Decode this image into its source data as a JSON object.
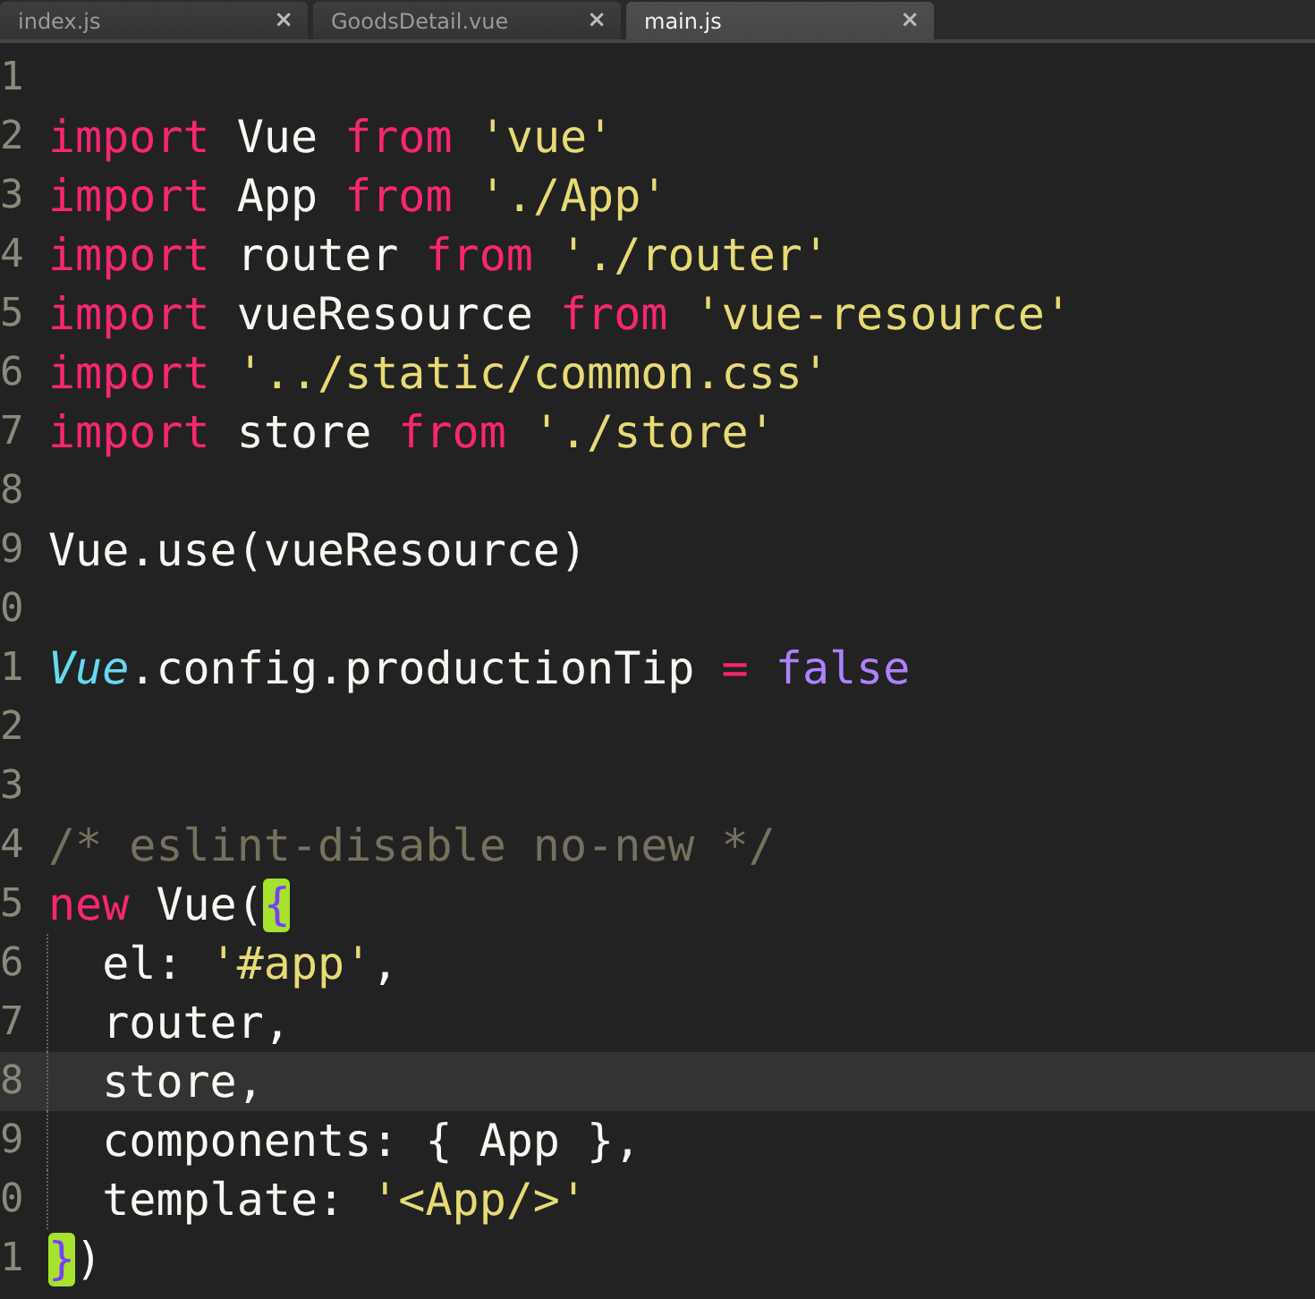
{
  "tabs": [
    {
      "label": "index.js",
      "close": "×",
      "selected": false
    },
    {
      "label": "GoodsDetail.vue",
      "close": "×",
      "selected": false
    },
    {
      "label": "main.js",
      "close": "×",
      "selected": true
    }
  ],
  "editor": {
    "lines": [
      {
        "number": "1",
        "current": false,
        "indent_guide": false
      },
      {
        "number": "2",
        "current": false,
        "indent_guide": false,
        "tokens": [
          {
            "kind": "keyword",
            "text": "import"
          },
          {
            "kind": "plain",
            "text": " Vue "
          },
          {
            "kind": "keyword",
            "text": "from "
          },
          {
            "kind": "string",
            "text": "'vue'"
          }
        ]
      },
      {
        "number": "3",
        "current": false,
        "indent_guide": false,
        "tokens": [
          {
            "kind": "keyword",
            "text": "import"
          },
          {
            "kind": "plain",
            "text": " App "
          },
          {
            "kind": "keyword",
            "text": "from "
          },
          {
            "kind": "string",
            "text": "'./App'"
          }
        ]
      },
      {
        "number": "4",
        "current": false,
        "indent_guide": false,
        "tokens": [
          {
            "kind": "keyword",
            "text": "import"
          },
          {
            "kind": "plain",
            "text": " router "
          },
          {
            "kind": "keyword",
            "text": "from "
          },
          {
            "kind": "string",
            "text": "'./router'"
          }
        ]
      },
      {
        "number": "5",
        "current": false,
        "indent_guide": false,
        "tokens": [
          {
            "kind": "keyword",
            "text": "import"
          },
          {
            "kind": "plain",
            "text": " vueResource "
          },
          {
            "kind": "keyword",
            "text": "from "
          },
          {
            "kind": "string",
            "text": "'vue-resource'"
          }
        ]
      },
      {
        "number": "6",
        "current": false,
        "indent_guide": false,
        "tokens": [
          {
            "kind": "keyword",
            "text": "import "
          },
          {
            "kind": "string",
            "text": "'../static/common.css'"
          }
        ]
      },
      {
        "number": "7",
        "current": false,
        "indent_guide": false,
        "tokens": [
          {
            "kind": "keyword",
            "text": "import"
          },
          {
            "kind": "plain",
            "text": " store "
          },
          {
            "kind": "keyword",
            "text": "from "
          },
          {
            "kind": "string",
            "text": "'./store'"
          }
        ]
      },
      {
        "number": "8",
        "current": false,
        "indent_guide": false
      },
      {
        "number": "9",
        "current": false,
        "indent_guide": false,
        "tokens": [
          {
            "kind": "plain",
            "text": "Vue.use(vueResource)"
          }
        ]
      },
      {
        "number": "0",
        "current": false,
        "indent_guide": false
      },
      {
        "number": "1",
        "current": false,
        "indent_guide": false,
        "tokens": [
          {
            "kind": "class",
            "text": "Vue"
          },
          {
            "kind": "plain",
            "text": ".config.productionTip "
          },
          {
            "kind": "keyword",
            "text": "= "
          },
          {
            "kind": "constant",
            "text": "false"
          }
        ]
      },
      {
        "number": "2",
        "current": false,
        "indent_guide": false
      },
      {
        "number": "3",
        "current": false,
        "indent_guide": false
      },
      {
        "number": "4",
        "current": false,
        "indent_guide": false,
        "tokens": [
          {
            "kind": "comment",
            "text": "/* eslint-disable no-new */"
          }
        ]
      },
      {
        "number": "5",
        "current": false,
        "indent_guide": false,
        "tokens": [
          {
            "kind": "keyword",
            "text": "new"
          },
          {
            "kind": "plain",
            "text": " Vue("
          },
          {
            "kind": "bracket-match",
            "text": "{"
          }
        ]
      },
      {
        "number": "6",
        "current": false,
        "indent_guide": true,
        "tokens": [
          {
            "kind": "plain",
            "text": "  el: "
          },
          {
            "kind": "string",
            "text": "'#app'"
          },
          {
            "kind": "plain",
            "text": ","
          }
        ]
      },
      {
        "number": "7",
        "current": false,
        "indent_guide": true,
        "tokens": [
          {
            "kind": "plain",
            "text": "  router,"
          }
        ]
      },
      {
        "number": "8",
        "current": true,
        "indent_guide": true,
        "tokens": [
          {
            "kind": "plain",
            "text": "  store,"
          }
        ]
      },
      {
        "number": "9",
        "current": false,
        "indent_guide": true,
        "tokens": [
          {
            "kind": "plain",
            "text": "  components: { App },"
          }
        ]
      },
      {
        "number": "0",
        "current": false,
        "indent_guide": true,
        "tokens": [
          {
            "kind": "plain",
            "text": "  template: "
          },
          {
            "kind": "string",
            "text": "'<App/>'"
          }
        ]
      },
      {
        "number": "1",
        "current": false,
        "indent_guide": false,
        "tokens": [
          {
            "kind": "bracket-match",
            "text": "}"
          },
          {
            "kind": "plain",
            "text": ")"
          }
        ]
      }
    ]
  }
}
